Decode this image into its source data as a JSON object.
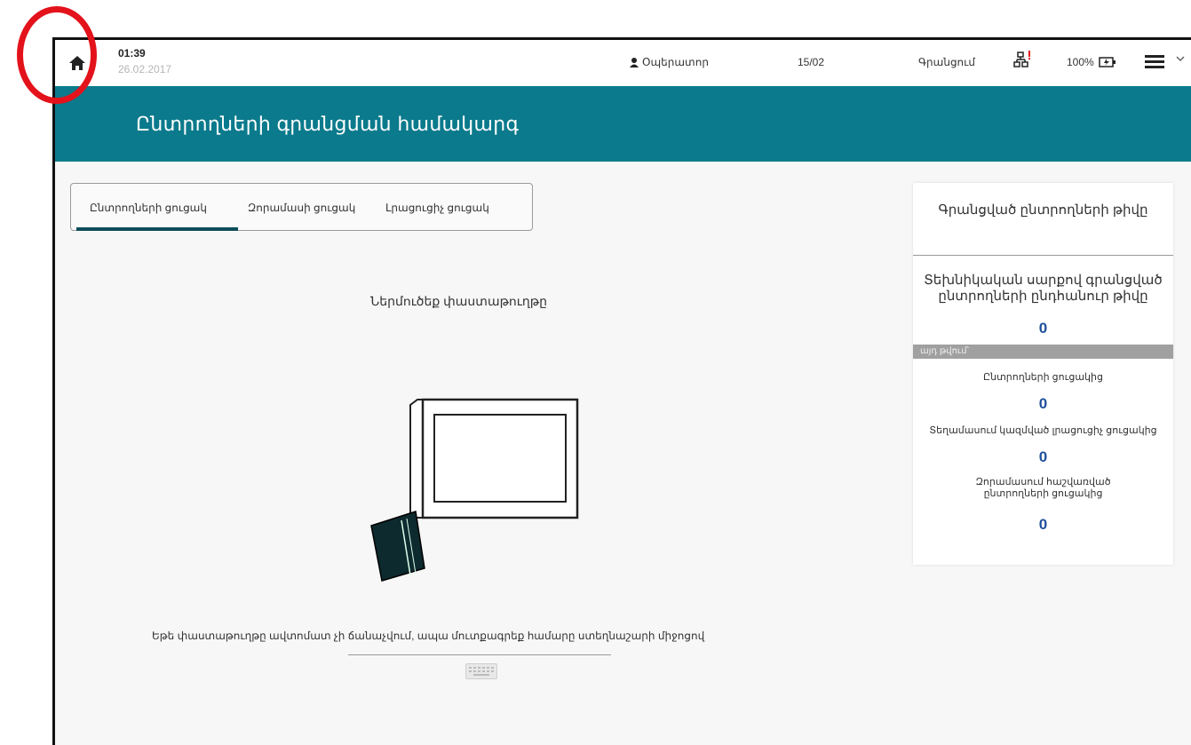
{
  "topbar": {
    "time": "01:39",
    "date": "26.02.2017",
    "operator_label": "Օպերատոր",
    "counter": "15/02",
    "register_label": "Գրանցում",
    "battery": "100%",
    "icons": [
      "home-icon",
      "user-icon",
      "network-alert-icon",
      "battery-charging-icon",
      "menu-icon",
      "chevron-down-icon"
    ]
  },
  "banner": {
    "title": "Ընտրողների գրանցման համակարգ"
  },
  "tabs": [
    {
      "label": "Ընտրողների ցուցակ",
      "active": true
    },
    {
      "label": "Զորամասի ցուցակ",
      "active": false
    },
    {
      "label": "Լրացուցիչ ցուցակ",
      "active": false
    }
  ],
  "main": {
    "prompt": "Ներմուծեք փաստաթուղթը",
    "keyboard_hint": "Եթե փաստաթուղթը ավտոմատ չի ճանաչվում, ապա մուտքագրեք համարը ստեղնաշարի միջոցով"
  },
  "panel": {
    "title": "Գրանցված ընտրողների թիվը",
    "subtitle": "Տեխնիկական սարքով գրանցված ընտրողների ընդհանուր թիվը",
    "total": "0",
    "breakdown_label": "այդ թվում՝",
    "items": [
      {
        "label": "Ընտրողների ցուցակից",
        "value": "0"
      },
      {
        "label": "Տեղամասում կազմված լրացուցիչ ցուցակից",
        "value": "0"
      },
      {
        "label": "Զորամասում հաշվառված ընտրողների ցուցակից",
        "value": "0"
      }
    ]
  },
  "colors": {
    "accent": "#0b7a8c",
    "count": "#1e4f9c",
    "annotation": "#e3121b"
  }
}
